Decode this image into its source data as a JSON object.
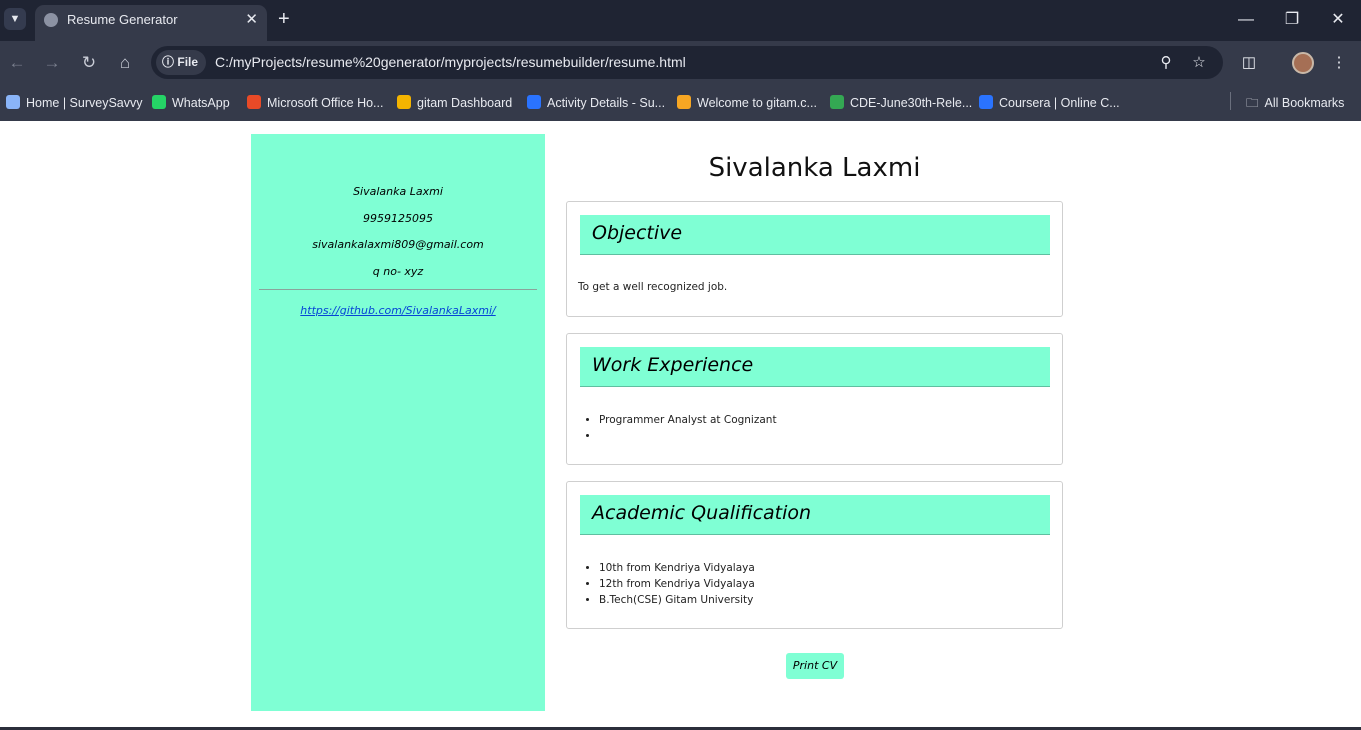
{
  "browser": {
    "tab": {
      "title": "Resume Generator"
    },
    "address": {
      "scheme_label": "File",
      "url": "C:/myProjects/resume%20generator/myprojects/resumebuilder/resume.html"
    },
    "bookmarks": [
      {
        "label": "Home | SurveySavvy",
        "color": "#8ab4f8"
      },
      {
        "label": "WhatsApp",
        "color": "#25d366"
      },
      {
        "label": "Microsoft Office Ho...",
        "color": "#e84a27"
      },
      {
        "label": "gitam Dashboard",
        "color": "#f4b400"
      },
      {
        "label": "Activity Details - Su...",
        "color": "#2a73ff"
      },
      {
        "label": "Welcome to gitam.c...",
        "color": "#f6a623"
      },
      {
        "label": "CDE-June30th-Rele...",
        "color": "#34a853"
      },
      {
        "label": "Coursera | Online C...",
        "color": "#2a73ff"
      }
    ],
    "all_bookmarks_label": "All Bookmarks"
  },
  "sidebar": {
    "name": "Sivalanka Laxmi",
    "phone": "9959125095",
    "email": "sivalankalaxmi809@gmail.com",
    "address": "q no- xyz",
    "github": "https://github.com/SivalankaLaxmi/"
  },
  "main": {
    "name": "Sivalanka Laxmi",
    "objective": {
      "title": "Objective",
      "text": "To get a well recognized job."
    },
    "work": {
      "title": "Work Experience",
      "items": [
        "Programmer Analyst at Cognizant",
        ""
      ]
    },
    "academic": {
      "title": "Academic Qualification",
      "items": [
        "10th from Kendriya Vidyalaya",
        "12th from Kendriya Vidyalaya",
        "B.Tech(CSE) Gitam University"
      ]
    },
    "print_label": "Print CV"
  },
  "colors": {
    "accent": "#7fffd4",
    "chrome_dark": "#1f2433",
    "chrome_mid": "#353a4a",
    "link": "#0645d6"
  }
}
